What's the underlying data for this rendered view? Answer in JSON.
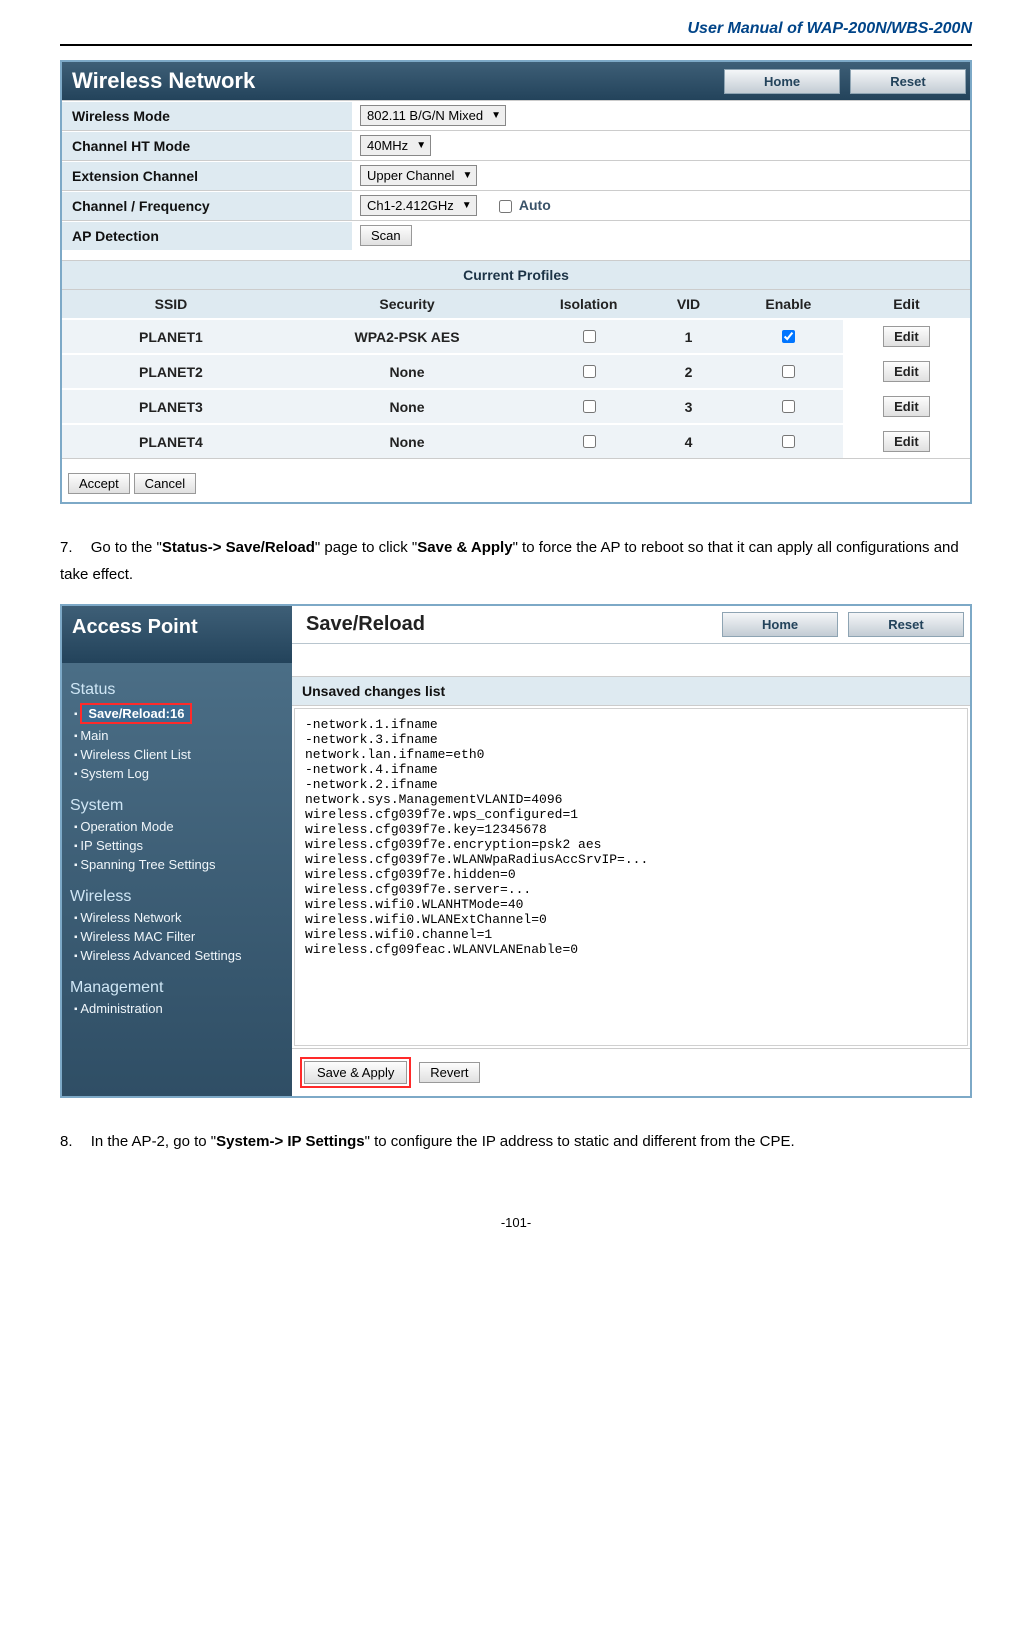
{
  "doc_header": "User Manual of WAP-200N/WBS-200N",
  "page_number": "-101-",
  "panel1": {
    "title": "Wireless Network",
    "home_btn": "Home",
    "reset_btn": "Reset",
    "rows": {
      "wireless_mode": {
        "label": "Wireless Mode",
        "value": "802.11 B/G/N Mixed"
      },
      "channel_ht": {
        "label": "Channel HT Mode",
        "value": "40MHz"
      },
      "ext_channel": {
        "label": "Extension Channel",
        "value": "Upper Channel"
      },
      "channel_freq": {
        "label": "Channel / Frequency",
        "value": "Ch1-2.412GHz",
        "auto_label": "Auto"
      },
      "ap_detection": {
        "label": "AP Detection",
        "scan_btn": "Scan"
      }
    },
    "current_profiles_title": "Current Profiles",
    "profiles_headers": {
      "ssid": "SSID",
      "security": "Security",
      "isolation": "Isolation",
      "vid": "VID",
      "enable": "Enable",
      "edit": "Edit"
    },
    "profiles": [
      {
        "ssid": "PLANET1",
        "security": "WPA2-PSK AES",
        "isolation": false,
        "vid": "1",
        "enable": true
      },
      {
        "ssid": "PLANET2",
        "security": "None",
        "isolation": false,
        "vid": "2",
        "enable": false
      },
      {
        "ssid": "PLANET3",
        "security": "None",
        "isolation": false,
        "vid": "3",
        "enable": false
      },
      {
        "ssid": "PLANET4",
        "security": "None",
        "isolation": false,
        "vid": "4",
        "enable": false
      }
    ],
    "edit_btn": "Edit",
    "accept_btn": "Accept",
    "cancel_btn": "Cancel"
  },
  "step7": {
    "num": "7.",
    "pre": "Go to the \"",
    "b1": "Status-> Save/Reload",
    "mid": "\" page to click \"",
    "b2": "Save & Apply",
    "post": "\" to force the AP to reboot so that it can apply all configurations and take effect."
  },
  "panel2": {
    "sidebar_title": "Access Point",
    "sections": {
      "status": {
        "title": "Status",
        "items": [
          "Main",
          "Wireless Client List",
          "System Log"
        ],
        "highlight": "Save/Reload:16"
      },
      "system": {
        "title": "System",
        "items": [
          "Operation Mode",
          "IP Settings",
          "Spanning Tree Settings"
        ]
      },
      "wireless": {
        "title": "Wireless",
        "items": [
          "Wireless Network",
          "Wireless MAC Filter",
          "Wireless Advanced Settings"
        ]
      },
      "management": {
        "title": "Management",
        "items": [
          "Administration"
        ]
      }
    },
    "main_title": "Save/Reload",
    "home_btn": "Home",
    "reset_btn": "Reset",
    "ucl_label": "Unsaved changes list",
    "ucl_text": "-network.1.ifname\n-network.3.ifname\nnetwork.lan.ifname=eth0\n-network.4.ifname\n-network.2.ifname\nnetwork.sys.ManagementVLANID=4096\nwireless.cfg039f7e.wps_configured=1\nwireless.cfg039f7e.key=12345678\nwireless.cfg039f7e.encryption=psk2 aes\nwireless.cfg039f7e.WLANWpaRadiusAccSrvIP=...\nwireless.cfg039f7e.hidden=0\nwireless.cfg039f7e.server=...\nwireless.wifi0.WLANHTMode=40\nwireless.wifi0.WLANExtChannel=0\nwireless.wifi0.channel=1\nwireless.cfg09feac.WLANVLANEnable=0",
    "save_apply_btn": "Save & Apply",
    "revert_btn": "Revert"
  },
  "step8": {
    "num": "8.",
    "pre": "In the AP-2, go to \"",
    "b1": "System-> IP Settings",
    "post": "\" to configure the IP address to static and different from the CPE."
  }
}
